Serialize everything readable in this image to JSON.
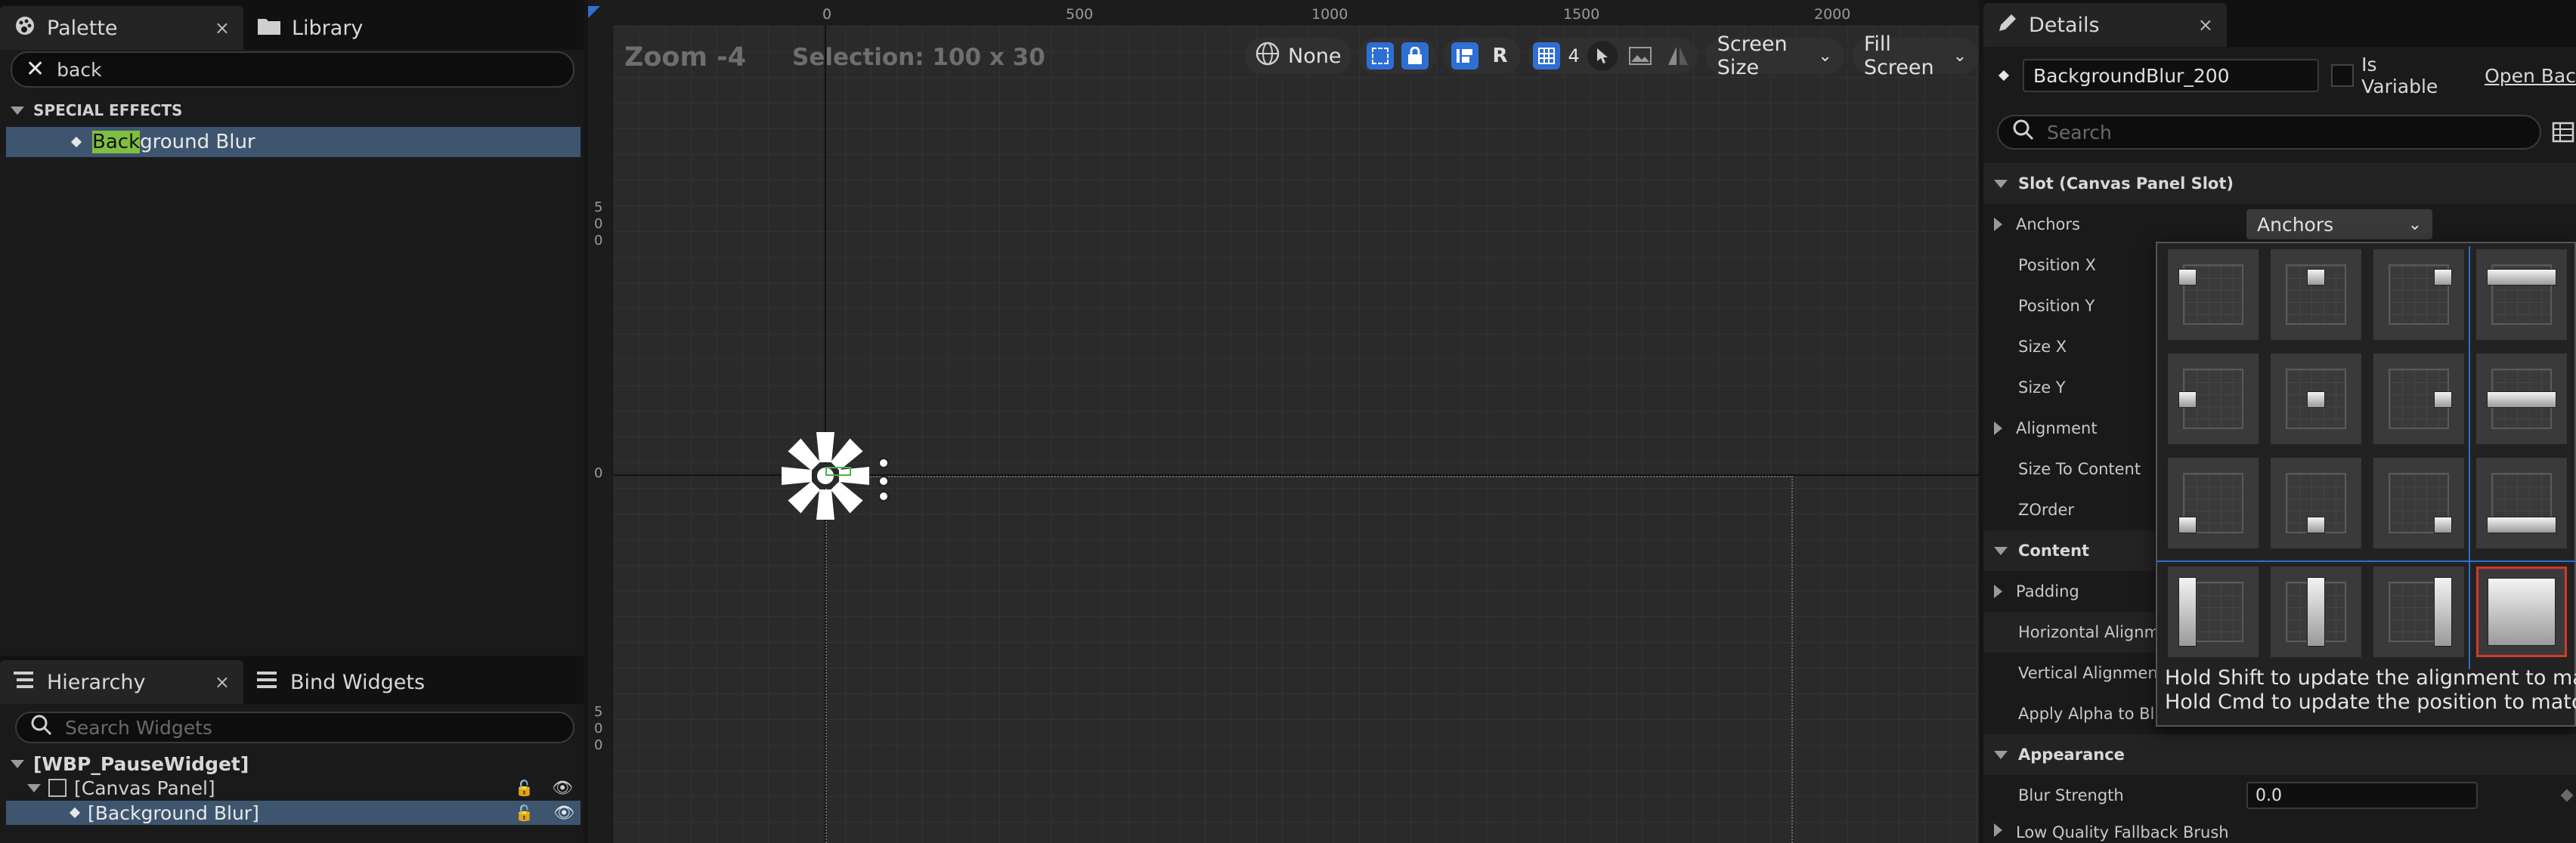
{
  "palette": {
    "tabs": [
      {
        "label": "Palette",
        "close": "×"
      },
      {
        "label": "Library"
      }
    ],
    "search_value": "back",
    "section": "SPECIAL EFFECTS",
    "item_match": "Back",
    "item_rest": "ground Blur"
  },
  "hierarchy": {
    "tabs": [
      {
        "label": "Hierarchy",
        "close": "×"
      },
      {
        "label": "Bind Widgets"
      }
    ],
    "search_placeholder": "Search Widgets",
    "tree": [
      "[WBP_PauseWidget]",
      "[Canvas Panel]",
      "[Background Blur]"
    ]
  },
  "viewport": {
    "zoom": "Zoom -4",
    "selection": "Selection: 100 x 30",
    "ruler_top": [
      "0",
      "500",
      "1000",
      "1500",
      "2000"
    ],
    "ruler_left": [
      {
        "label": [
          "5",
          "0",
          "0"
        ]
      },
      {
        "label": [
          "0"
        ]
      },
      {
        "label": [
          "5",
          "0",
          "0"
        ]
      }
    ],
    "toolbar": {
      "localization": "None",
      "r_label": "R",
      "grid_snap": "4",
      "screen_size": "Screen Size",
      "fill_screen": "Fill Screen"
    }
  },
  "details": {
    "tab": {
      "label": "Details",
      "close": "×"
    },
    "widget_name": "BackgroundBlur_200",
    "is_variable_label": "Is Variable",
    "open_bac": "Open Bac",
    "search_placeholder": "Search",
    "sections": {
      "slot": "Slot (Canvas Panel Slot)",
      "content": "Content",
      "appearance": "Appearance"
    },
    "props": {
      "anchors": "Anchors",
      "anchors_value": "Anchors",
      "position_x": "Position X",
      "position_y": "Position Y",
      "size_x": "Size X",
      "size_y": "Size Y",
      "alignment": "Alignment",
      "size_to_content": "Size To Content",
      "zorder": "ZOrder",
      "padding": "Padding",
      "horizontal_alignment": "Horizontal Alignme",
      "vertical_alignment": "Vertical Alignment",
      "apply_alpha": "Apply Alpha to Blur",
      "blur_strength": "Blur Strength",
      "blur_strength_value": "0.0",
      "low_quality": "Low Quality Fallback Brush"
    },
    "anchor_popup": {
      "hint_shift": "Hold Shift to update the alignment to match.",
      "hint_cmd": "Hold Cmd to update the position to match."
    }
  },
  "colors": {
    "accent_blue": "#2e6fd3",
    "selection_row": "#3e556f",
    "match_highlight": "#7fbf3f",
    "anchor_selected": "#d23a2a"
  }
}
